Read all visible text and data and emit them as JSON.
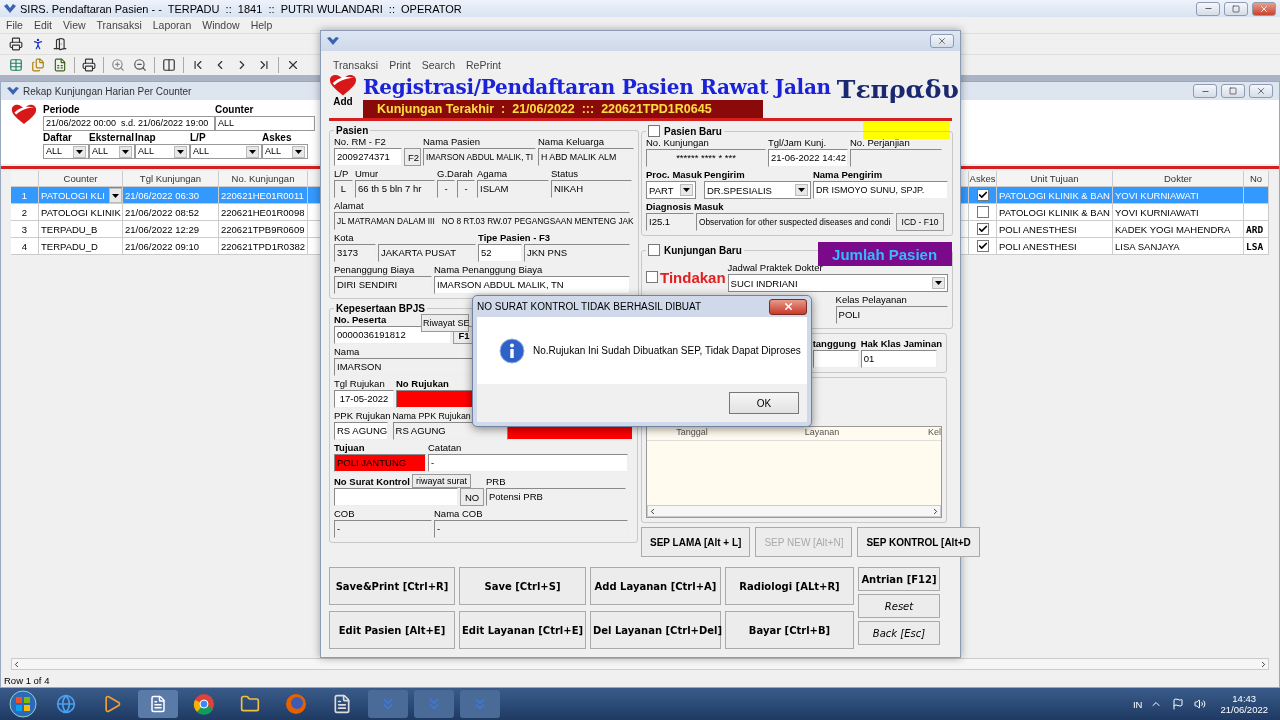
{
  "app": {
    "title": "SIRS. Pendaftaran Pasien - -  TERPADU  ::  1841  ::  PUTRI WULANDARI  ::  OPERATOR",
    "menu": [
      "File",
      "Edit",
      "View",
      "Transaksi",
      "Laporan",
      "Window",
      "Help"
    ]
  },
  "rekap": {
    "title": "Rekap Kunjungan Harian Per Counter",
    "periode": {
      "label": "Periode",
      "value": "21/06/2022 00:00  s.d. 21/06/2022 19:00"
    },
    "counter": {
      "label": "Counter",
      "value": "ALL"
    },
    "filters": [
      {
        "label": "Daftar",
        "value": "ALL"
      },
      {
        "label": "Eksternal",
        "value": "ALL"
      },
      {
        "label": "Inap",
        "value": "ALL"
      },
      {
        "label": "L/P",
        "value": "ALL"
      },
      {
        "label": "Askes",
        "value": "ALL"
      }
    ],
    "left_columns": [
      "Counter",
      "Tgl Kunjungan",
      "No. Kunjungan"
    ],
    "right_columns": [
      "Askes",
      "Unit Tujuan",
      "Dokter",
      "No"
    ],
    "rows": [
      {
        "number": "1",
        "counter": "PATOLOGI KLI",
        "tgl": "21/06/2022 06:30",
        "no_kunjungan": "220621HE01R0011",
        "askes": true,
        "unit": "PATOLOGI KLINIK & BAN",
        "dokter": "YOVI KURNIAWATI",
        "selected": true
      },
      {
        "number": "2",
        "counter": "PATOLOGI KLINIK",
        "tgl": "21/06/2022 08:52",
        "no_kunjungan": "220621HE01R0098",
        "askes": false,
        "unit": "PATOLOGI KLINIK & BAN",
        "dokter": "YOVI KURNIAWATI",
        "selected": false
      },
      {
        "number": "3",
        "counter": "TERPADU_B",
        "tgl": "21/06/2022 12:29",
        "no_kunjungan": "220621TPB9R0609",
        "askes": true,
        "unit": "POLI ANESTHESI",
        "dokter": "KADEK YOGI MAHENDRA",
        "no": "ARD",
        "selected": false
      },
      {
        "number": "4",
        "counter": "TERPADU_D",
        "tgl": "21/06/2022 09:10",
        "no_kunjungan": "220621TPD1R0382",
        "askes": true,
        "unit": "POLI ANESTHESI",
        "dokter": "LISA SANJAYA",
        "no": "LSA",
        "selected": false
      }
    ],
    "status": "Row 1 of 4"
  },
  "form": {
    "menu": [
      "Transaksi",
      "Print",
      "Search",
      "RePrint"
    ],
    "add_label": "Add",
    "title": "Registrasi/Pendaftaran Pasien Rawat Jalan",
    "logo": "Τεπραδυ",
    "last_visit": "Kunjungan Terakhir  :  21/06/2022  :::  220621TPD1R0645",
    "pasien": {
      "legend": "Pasien",
      "no_rm": {
        "label": "No. RM - F2",
        "value": "2009274371",
        "button": "F2"
      },
      "nama_pasien": {
        "label": "Nama Pasien",
        "value": "IMARSON ABDUL MALIK, TI"
      },
      "nama_keluarga": {
        "label": "Nama Keluarga",
        "value": "H ABD MALIK ALM"
      },
      "lp": {
        "label": "L/P",
        "value": "L"
      },
      "umur": {
        "label": "Umur",
        "value": "66 th 5 bln 7 hr"
      },
      "gdarah": {
        "label": "G.Darah",
        "values": [
          "-",
          "-"
        ]
      },
      "agama": {
        "label": "Agama",
        "value": "ISLAM"
      },
      "status": {
        "label": "Status",
        "value": "NIKAH"
      },
      "alamat": {
        "label": "Alamat",
        "value": "JL MATRAMAN DALAM III   NO 8 RT.03 RW.07 PEGANGSAAN MENTENG JAK"
      },
      "kota": {
        "label": "Kota",
        "code": "3173",
        "name": "JAKARTA PUSAT"
      },
      "tipe": {
        "label": "Tipe Pasien - F3",
        "code": "52",
        "name": "JKN PNS"
      },
      "penanggung": {
        "label": "Penanggung Biaya",
        "value": "DIRI SENDIRI"
      },
      "nama_penanggung": {
        "label": "Nama Penanggung Biaya",
        "value": "IMARSON ABDUL MALIK, TN"
      }
    },
    "bpjs": {
      "legend": "Kepesertaan BPJS",
      "no_peserta": {
        "label": "No. Peserta",
        "value": "0000036191812",
        "button": "F1"
      },
      "riwayat_sep": "Riwayat SE",
      "nama": {
        "label": "Nama",
        "value": "IMARSON"
      },
      "tgl_rujukan": {
        "label": "Tgl Rujukan",
        "value": "17-05-2022"
      },
      "no_rujukan": {
        "label": "No Rujukan"
      },
      "ppk": {
        "label": "PPK Rujukan",
        "value": "RS AGUNG"
      },
      "nama_ppk": {
        "label": "Nama PPK Rujukan",
        "value": "RS AGUNG"
      },
      "tujuan": {
        "label": "Tujuan",
        "value": "POLI JANTUNG"
      },
      "catatan": {
        "label": "Catatan",
        "value": "-"
      },
      "surat_kontrol": {
        "label": "No Surat Kontrol",
        "history": "riwayat surat",
        "button": "NO"
      },
      "prb": {
        "label": "PRB",
        "value": "Potensi PRB"
      },
      "cob": {
        "label": "COB",
        "value": "-"
      },
      "nama_cob": {
        "label": "Nama COB",
        "value": "-"
      }
    },
    "pasien_baru": {
      "label": "Pasien Baru",
      "checked": false,
      "no_kunjungan": {
        "label": "No. Kunjungan",
        "value": "****** **** * ***"
      },
      "tgl_jam": {
        "label": "Tgl/Jam Kunj.",
        "value": "21-06-2022 14:42"
      },
      "no_perjanjian": {
        "label": "No. Perjanjian"
      },
      "proc_masuk": {
        "label": "Proc. Masuk",
        "value": "PART"
      },
      "pengirim": {
        "label": "Pengirim",
        "value": "DR.SPESIALIS"
      },
      "nama_pengirim": {
        "label": "Nama Pengirim",
        "value": "DR ISMOYO SUNU, SPJP."
      },
      "diagnosis": {
        "label": "Diagnosis Masuk",
        "code": "I25.1",
        "text": "Observation for other suspected diseases and condi",
        "button": "ICD - F10"
      }
    },
    "kunjungan_baru": {
      "label": "Kunjungan Baru",
      "checked": false,
      "jumlah_pasien": "Jumlah Pasien",
      "tindakan": {
        "label": "Tindakan",
        "checked": false
      },
      "jadwal": {
        "label": "Jadwal Praktek Dokter",
        "value": "SUCI INDRIANI"
      },
      "kelas": {
        "label": "Kelas Pelayanan",
        "value": "POLI"
      },
      "penanggung_label": "tanggung",
      "hak_klas": {
        "label": "Hak Klas Jaminan",
        "value": "01"
      }
    },
    "layanan_columns": [
      "Tanggal",
      "Layanan",
      "Kel"
    ],
    "sep_buttons": [
      {
        "label": "SEP LAMA [Alt + L]",
        "disabled": false
      },
      {
        "label": "SEP NEW [Alt+N]",
        "disabled": true
      },
      {
        "label": "SEP KONTROL [Alt+D",
        "disabled": false
      }
    ],
    "action_buttons": [
      "Save&Print [Ctrl+R]",
      "Save [Ctrl+S]",
      "Add Layanan [Ctrl+A]",
      "Radiologi [ALt+R]",
      "Edit Pasien [Alt+E]",
      "Edit Layanan [Ctrl+E]",
      "Del Layanan [Ctrl+Del]",
      "Bayar [Ctrl+B]"
    ],
    "side_buttons": [
      {
        "label": "Antrian [F12]",
        "kind": "bold"
      },
      {
        "label": "Reset",
        "kind": "italic"
      },
      {
        "label": "Back [Esc]",
        "kind": "italic"
      }
    ]
  },
  "dialog": {
    "title": "NO SURAT KONTROL TIDAK BERHASIL DIBUAT",
    "message": "No.Rujukan Ini Sudah Dibuatkan SEP, Tidak Dapat Diproses",
    "ok": "OK"
  },
  "taskbar": {
    "language": "IN",
    "time": "14:43",
    "date": "21/06/2022"
  }
}
